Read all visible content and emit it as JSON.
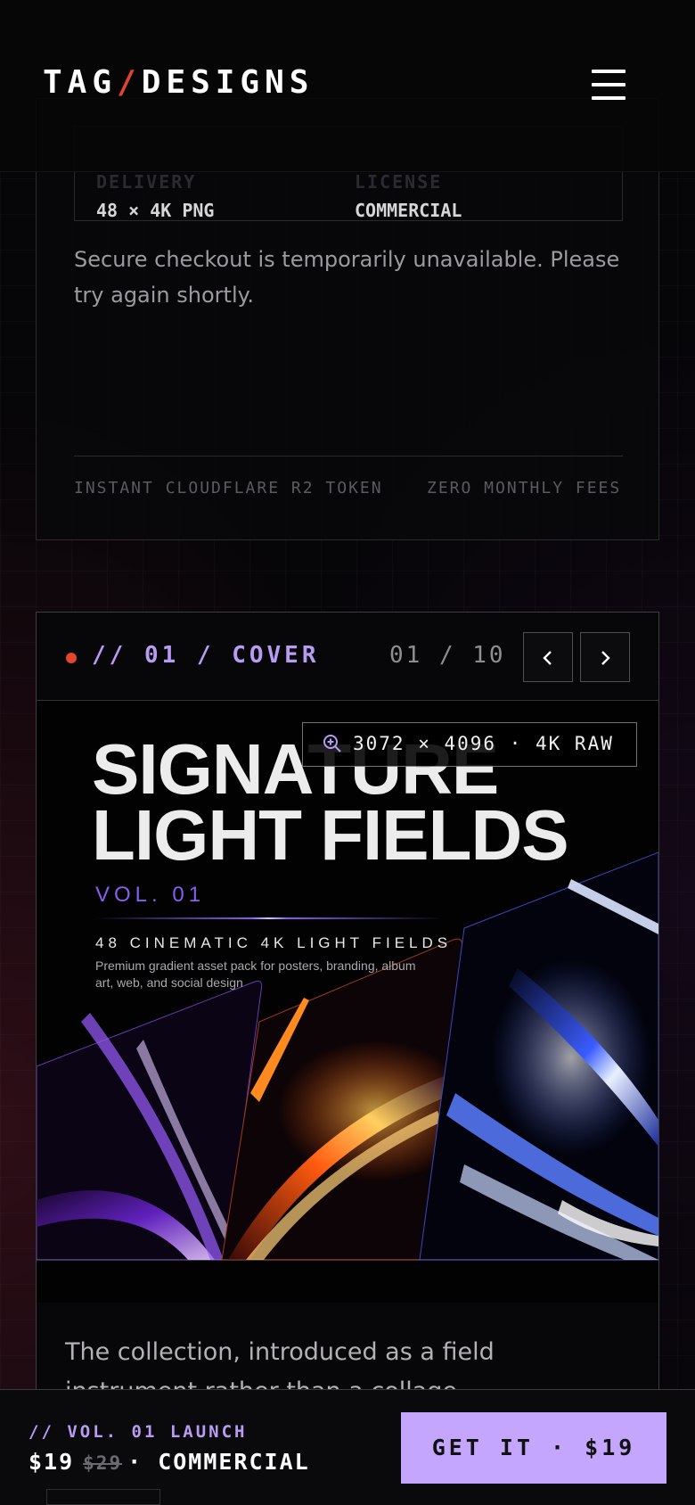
{
  "header": {
    "logo_left": "TAG",
    "logo_slash": "/",
    "logo_right": "DESIGNS",
    "menu_icon": "hamburger-menu-icon"
  },
  "checkout_panel": {
    "specs": [
      {
        "key": "DELIVERY",
        "value": "48 × 4K PNG"
      },
      {
        "key": "LICENSE",
        "value": "COMMERCIAL"
      }
    ],
    "message": "Secure checkout is temporarily unavailable. Please try again shortly.",
    "features": [
      "INSTANT CLOUDFLARE R2 TOKEN",
      "ZERO MONTHLY FEES"
    ]
  },
  "gallery": {
    "title": "// 01 / COVER",
    "counter": "01 / 10",
    "prev_icon": "chevron-left-icon",
    "next_icon": "chevron-right-icon",
    "resolution_badge": "3072 × 4096 · 4K RAW",
    "zoom_icon": "zoom-in-icon",
    "cover": {
      "title_line1": "SIGNATURE",
      "title_line2": "LIGHT FIELDS",
      "volume": "VOL. 01",
      "subtitle": "48 CINEMATIC 4K LIGHT FIELDS",
      "description": "Premium gradient asset pack for posters, branding, album art, web, and social design"
    },
    "caption": "The collection, introduced as a field instrument rather than a collage."
  },
  "bottom_bar": {
    "label": "// VOL. 01 LAUNCH",
    "price": "$19",
    "old_price": "$29",
    "license": "· COMMERCIAL",
    "cta": "GET IT · $19"
  },
  "colors": {
    "accent": "#c4a6ff",
    "accent_text": "#b79cf2",
    "dot": "#e0472c",
    "background": "#060508"
  }
}
